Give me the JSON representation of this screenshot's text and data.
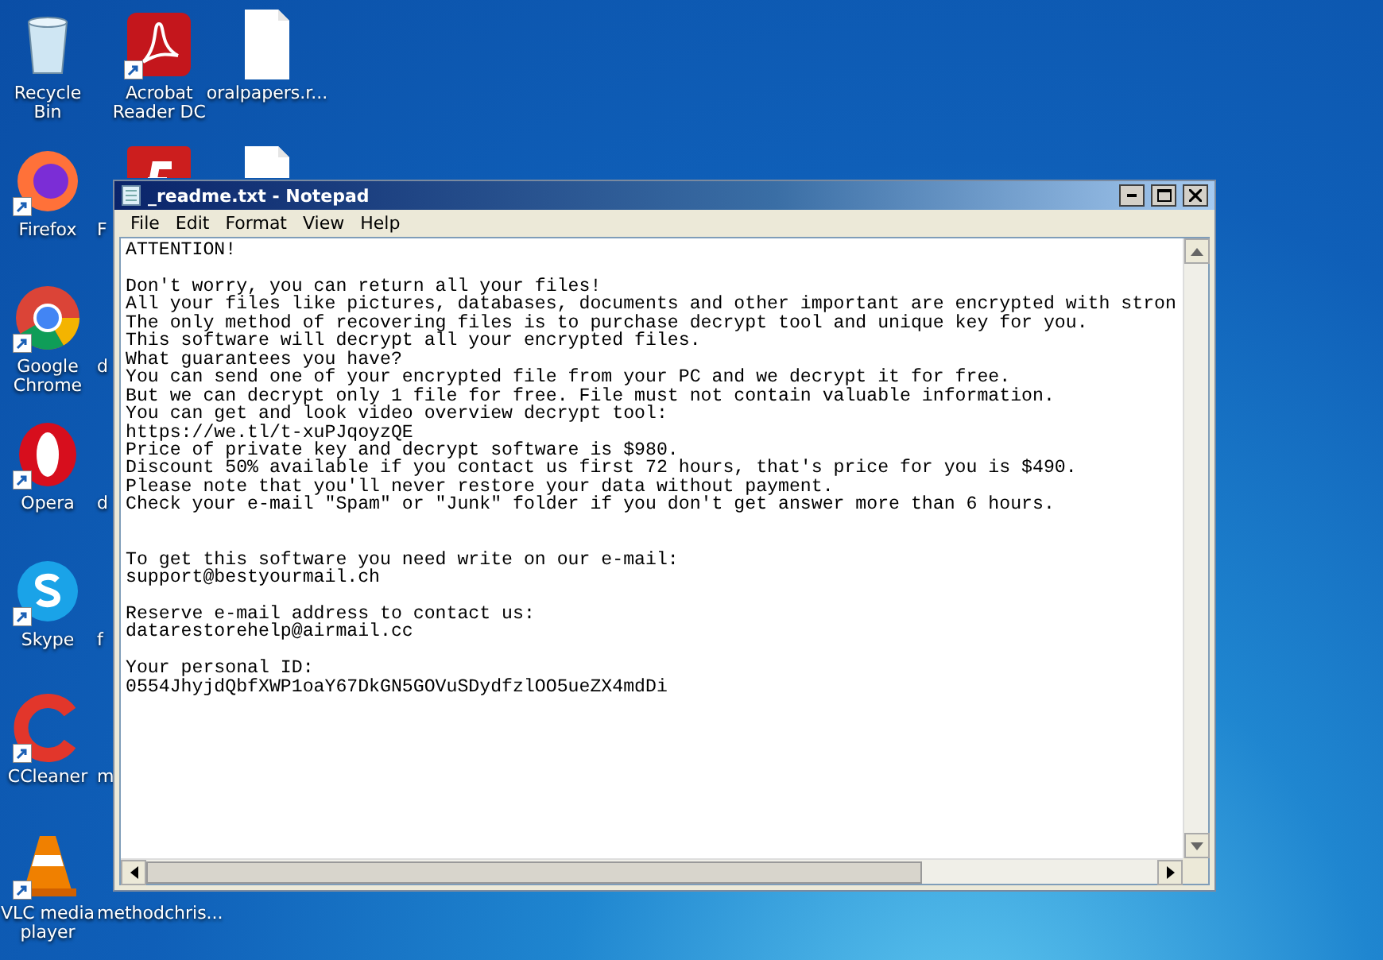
{
  "desktop_columns": [
    [
      {
        "kind": "recycle-bin",
        "label": "Recycle Bin",
        "shortcut": false,
        "covered": false
      },
      {
        "kind": "firefox",
        "label": "Firefox",
        "shortcut": true,
        "covered": false
      },
      {
        "kind": "chrome",
        "label": "Google Chrome",
        "shortcut": true,
        "covered": false
      },
      {
        "kind": "opera",
        "label": "Opera",
        "shortcut": true,
        "covered": false
      },
      {
        "kind": "skype",
        "label": "Skype",
        "shortcut": true,
        "covered": false
      },
      {
        "kind": "ccleaner",
        "label": "CCleaner",
        "shortcut": true,
        "covered": false
      },
      {
        "kind": "vlc",
        "label": "VLC media player",
        "shortcut": true,
        "covered": false
      }
    ],
    [
      {
        "kind": "acrobat",
        "label": "Acrobat Reader DC",
        "shortcut": true,
        "covered": false
      },
      {
        "kind": "flash",
        "label": "F",
        "shortcut": false,
        "covered": true
      },
      {
        "label": "d",
        "shortcut": false,
        "covered": true
      },
      {
        "label": "d",
        "shortcut": false,
        "covered": true
      },
      {
        "label": "f",
        "shortcut": false,
        "covered": true
      },
      {
        "label": "m",
        "shortcut": false,
        "covered": true
      },
      {
        "label": "methodchris...",
        "shortcut": false,
        "covered": true
      }
    ],
    [
      {
        "kind": "document",
        "label": "oralpapers.r...",
        "shortcut": false,
        "covered": false
      },
      {
        "kind": "document",
        "shortcut": false,
        "covered": true
      }
    ]
  ],
  "window": {
    "title": "_readme.txt - Notepad",
    "menu": [
      "File",
      "Edit",
      "Format",
      "View",
      "Help"
    ],
    "sections": [
      [
        [
          "ATTENTION!"
        ],
        [
          "Don't worry, you can return all your files!",
          "All your files like pictures, databases, documents and other important are encrypted with stron",
          "The only method of recovering files is to purchase decrypt tool and unique key for you.",
          "This software will decrypt all your encrypted files.",
          "What guarantees you have?",
          "You can send one of your encrypted file from your PC and we decrypt it for free.",
          "But we can decrypt only 1 file for free. File must not contain valuable information.",
          "You can get and look video overview decrypt tool:",
          "https://we.tl/t-xuPJqoyzQE",
          "Price of private key and decrypt software is $980.",
          "Discount 50% available if you contact us first 72 hours, that's price for you is $490.",
          "Please note that you'll never restore your data without payment.",
          "Check your e-mail \"Spam\" or \"Junk\" folder if you don't get answer more than 6 hours."
        ]
      ],
      [
        [
          "To get this software you need write on our e-mail:",
          "support@bestyourmail.ch"
        ],
        [
          "Reserve e-mail address to contact us:",
          "datarestorehelp@airmail.cc"
        ],
        [
          "Your personal ID:",
          "0554JhyjdQbfXWP1oaY67DkGN5GOVuSDydfzlOO5ueZX4mdDi"
        ]
      ]
    ]
  }
}
